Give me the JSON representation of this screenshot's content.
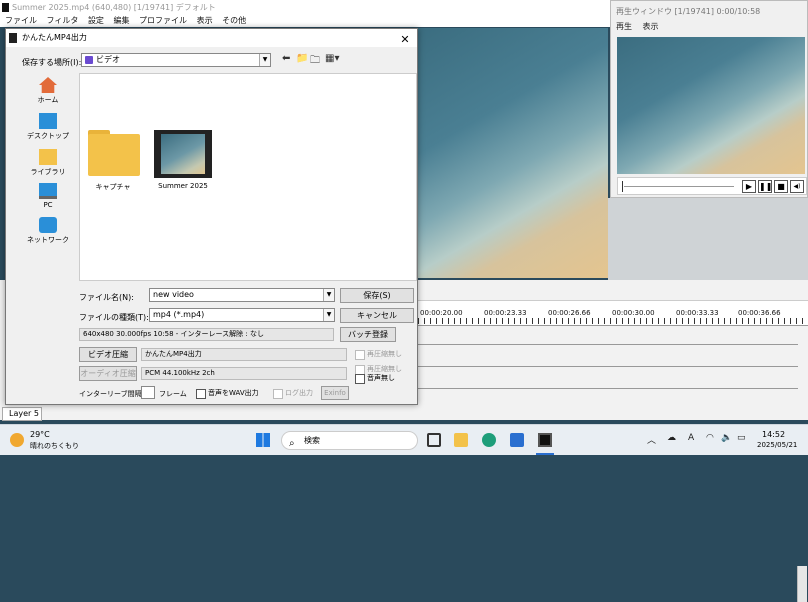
{
  "app": {
    "title": "Summer 2025.mp4 (640,480)  [1/19741]  デフォルト",
    "menu": [
      "ファイル",
      "フィルタ",
      "設定",
      "編集",
      "プロファイル",
      "表示",
      "その他"
    ]
  },
  "player": {
    "title": "再生ウィンドウ  [1/19741]  0:00/10:58",
    "menu": [
      "再生",
      "表示"
    ],
    "buttons": [
      "▶",
      "❚❚",
      "■",
      "◀)"
    ]
  },
  "timeline": {
    "ticks": [
      "00:00:20.00",
      "00:00:23.33",
      "00:00:26.66",
      "00:00:30.00",
      "00:00:33.33",
      "00:00:36.66"
    ],
    "layer": "Layer 5"
  },
  "dialog": {
    "title": "かんたんMP4出力",
    "save_in_label": "保存する場所(I):",
    "save_in_value": "ビデオ",
    "places": [
      "ホーム",
      "デスクトップ",
      "ライブラリ",
      "PC",
      "ネットワーク"
    ],
    "files": [
      {
        "name": "キャプチャ",
        "type": "folder"
      },
      {
        "name": "Summer 2025",
        "type": "video"
      }
    ],
    "filename_label": "ファイル名(N):",
    "filename_value": "new video",
    "filetype_label": "ファイルの種類(T):",
    "filetype_value": "mp4 (*.mp4)",
    "save_button": "保存(S)",
    "cancel_button": "キャンセル",
    "info_line": "640x480  30.000fps  10:58  -  インターレース解除 : なし",
    "batch_button": "バッチ登録",
    "video_button": "ビデオ圧縮",
    "video_info": "かんたんMP4出力",
    "audio_button": "オーディオ圧縮",
    "audio_info": "PCM 44.100kHz 2ch",
    "recompress1": "再圧縮無し",
    "recompress2": "再圧縮無し",
    "no_audio": "音声無し",
    "interleave_label": "インターリーブ間隔 :",
    "frame_label": "フレーム",
    "wav_output": "音声をWAV出力",
    "log_output": "ログ出力",
    "exinfo_button": "Exinfo"
  },
  "taskbar": {
    "temperature": "29°C",
    "condition": "晴れのちくもり",
    "search_placeholder": "検索",
    "time": "14:52",
    "date": "2025/05/21",
    "ime": "A"
  }
}
